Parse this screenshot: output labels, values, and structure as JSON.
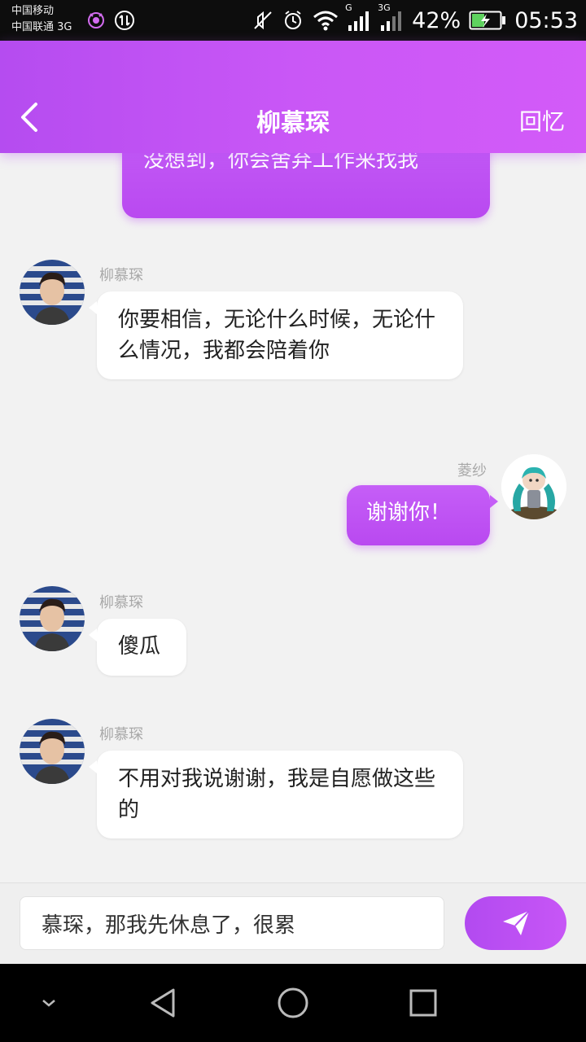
{
  "status_bar": {
    "carrier_1": "中国移动",
    "carrier_2": "中国联通 3G",
    "network_1": "G",
    "network_2": "3G",
    "battery": "42%",
    "time": "05:53"
  },
  "header": {
    "title": "柳慕琛",
    "action": "回忆",
    "back_icon": "chevron-left-icon"
  },
  "colors": {
    "accent": "#c056f5",
    "accent_dark": "#b24af0",
    "background": "#f2f2f2",
    "incoming_bubble": "#ffffff"
  },
  "messages": [
    {
      "side": "outgoing",
      "text": "没想到，你会舍弃工作来找我"
    },
    {
      "side": "incoming",
      "sender": "柳慕琛",
      "text": "你要相信，无论什么时候，无论什么情况，我都会陪着你"
    },
    {
      "side": "outgoing",
      "sender": "菱纱",
      "text": "谢谢你！"
    },
    {
      "side": "incoming",
      "sender": "柳慕琛",
      "text": "傻瓜"
    },
    {
      "side": "incoming",
      "sender": "柳慕琛",
      "text": "不用对我说谢谢，我是自愿做这些的"
    }
  ],
  "input": {
    "value": "慕琛，那我先休息了，很累",
    "send_icon": "paper-plane-icon"
  },
  "nav": {
    "hide_icon": "chevron-down-icon",
    "back_icon": "triangle-back-icon",
    "home_icon": "circle-home-icon",
    "recents_icon": "square-recents-icon"
  }
}
